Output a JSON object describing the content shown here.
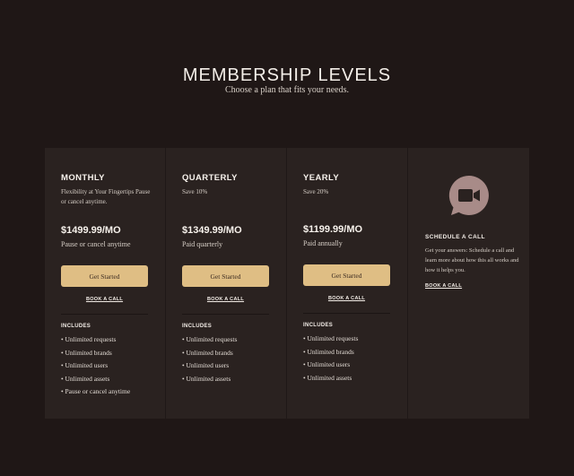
{
  "hero": {
    "title": "MEMBERSHIP LEVELS",
    "subtitle": "Choose a plan that fits your needs."
  },
  "plans": [
    {
      "name": "MONTHLY",
      "description": "Flexibility at Your Fingertips Pause or cancel anytime.",
      "price": "$1499.99/MO",
      "price_note": "Pause or cancel anytime",
      "cta_label": "Get Started",
      "book_label": "BOOK A CALL",
      "includes_heading": "INCLUDES",
      "features": [
        "• Unlimited requests",
        "• Unlimited brands",
        "• Unlimited users",
        "• Unlimited assets",
        "• Pause or cancel anytime"
      ]
    },
    {
      "name": "QUARTERLY",
      "description": "Save 10%",
      "price": "$1349.99/MO",
      "price_note": "Paid quarterly",
      "cta_label": "Get Started",
      "book_label": "BOOK A CALL",
      "includes_heading": "INCLUDES",
      "features": [
        "• Unlimited requests",
        "• Unlimited brands",
        "• Unlimited users",
        "• Unlimited assets"
      ]
    },
    {
      "name": "YEARLY",
      "description": "Save 20%",
      "price": "$1199.99/MO",
      "price_note": "Paid annually",
      "cta_label": "Get Started",
      "book_label": "BOOK A CALL",
      "includes_heading": "INCLUDES",
      "features": [
        "• Unlimited requests",
        "• Unlimited brands",
        "• Unlimited users",
        "• Unlimited assets"
      ]
    }
  ],
  "schedule": {
    "icon": "video-call-icon",
    "title": "SCHEDULE A CALL",
    "description": "Get your answers: Schedule a call and learn more about how this all works and how it helps you.",
    "book_label": "BOOK A CALL"
  },
  "colors": {
    "background": "#1f1716",
    "panel": "#2a2220",
    "accent": "#dfbe84",
    "icon": "#a88b88"
  }
}
